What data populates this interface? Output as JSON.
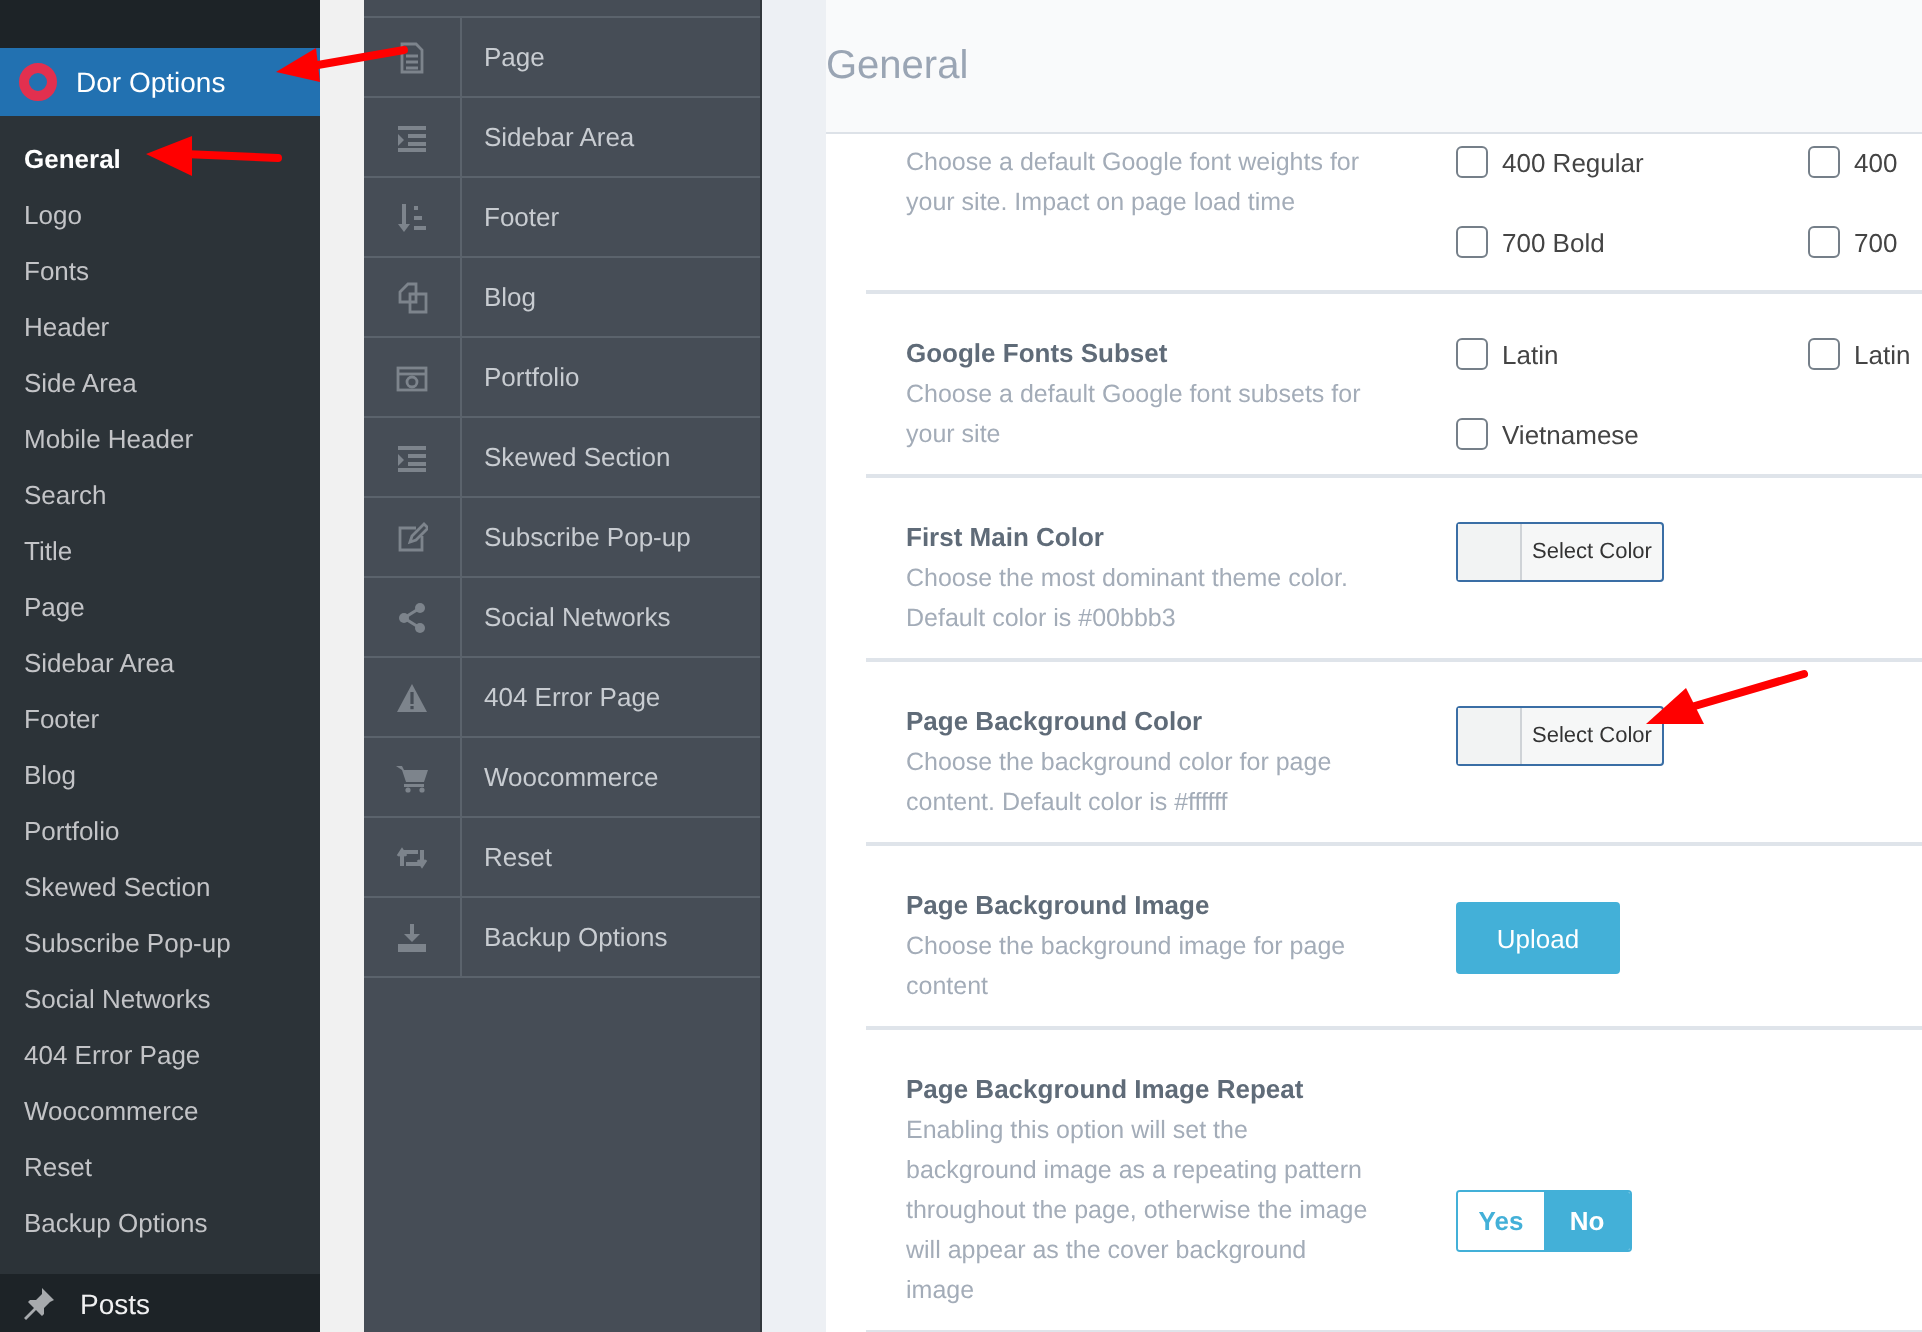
{
  "wp_menu": {
    "current": {
      "label": "Dor Options"
    },
    "submenu": [
      {
        "label": "General",
        "selected": true
      },
      {
        "label": "Logo",
        "selected": false
      },
      {
        "label": "Fonts",
        "selected": false
      },
      {
        "label": "Header",
        "selected": false
      },
      {
        "label": "Side Area",
        "selected": false
      },
      {
        "label": "Mobile Header",
        "selected": false
      },
      {
        "label": "Search",
        "selected": false
      },
      {
        "label": "Title",
        "selected": false
      },
      {
        "label": "Page",
        "selected": false
      },
      {
        "label": "Sidebar Area",
        "selected": false
      },
      {
        "label": "Footer",
        "selected": false
      },
      {
        "label": "Blog",
        "selected": false
      },
      {
        "label": "Portfolio",
        "selected": false
      },
      {
        "label": "Skewed Section",
        "selected": false
      },
      {
        "label": "Subscribe Pop-up",
        "selected": false
      },
      {
        "label": "Social Networks",
        "selected": false
      },
      {
        "label": "404 Error Page",
        "selected": false
      },
      {
        "label": "Woocommerce",
        "selected": false
      },
      {
        "label": "Reset",
        "selected": false
      },
      {
        "label": "Backup Options",
        "selected": false
      }
    ],
    "next": {
      "label": "Posts"
    }
  },
  "options_nav": [
    {
      "label": "Page"
    },
    {
      "label": "Sidebar Area"
    },
    {
      "label": "Footer"
    },
    {
      "label": "Blog"
    },
    {
      "label": "Portfolio"
    },
    {
      "label": "Skewed Section"
    },
    {
      "label": "Subscribe Pop-up"
    },
    {
      "label": "Social Networks"
    },
    {
      "label": "404 Error Page"
    },
    {
      "label": "Woocommerce"
    },
    {
      "label": "Reset"
    },
    {
      "label": "Backup Options"
    }
  ],
  "page": {
    "title": "General"
  },
  "settings": [
    {
      "kind": "checkboxes",
      "description": "Choose a default Google font weights for your site. Impact on page load time",
      "options": [
        {
          "label": "400 Regular",
          "checked": false
        },
        {
          "label": "400",
          "checked": false
        },
        {
          "label": "700 Bold",
          "checked": false
        },
        {
          "label": "700",
          "checked": false
        }
      ]
    },
    {
      "kind": "checkboxes",
      "title": "Google Fonts Subset",
      "description": "Choose a default Google font subsets for your site",
      "options": [
        {
          "label": "Latin",
          "checked": false
        },
        {
          "label": "Latin",
          "checked": false
        },
        {
          "label": "Vietnamese",
          "checked": false
        }
      ]
    },
    {
      "kind": "color",
      "title": "First Main Color",
      "description": "Choose the most dominant theme color. Default color is #00bbb3",
      "button": "Select Color"
    },
    {
      "kind": "color",
      "title": "Page Background Color",
      "description": "Choose the background color for page content. Default color is #ffffff",
      "button": "Select Color"
    },
    {
      "kind": "upload",
      "title": "Page Background Image",
      "description": "Choose the background image for page content",
      "button": "Upload"
    },
    {
      "kind": "toggle",
      "title": "Page Background Image Repeat",
      "description": "Enabling this option will set the background image as a repeating pattern throughout the page, otherwise the image will appear as the cover background image",
      "options": [
        {
          "label": "Yes",
          "selected": false
        },
        {
          "label": "No",
          "selected": true
        }
      ]
    }
  ]
}
